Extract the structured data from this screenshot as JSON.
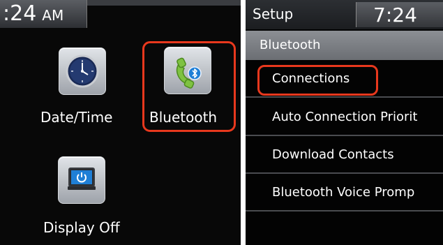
{
  "left_screen": {
    "clock": {
      "time": ":24",
      "ampm": "AM"
    },
    "items": [
      {
        "label": "Date/Time",
        "icon": "clock-icon"
      },
      {
        "label": "Bluetooth",
        "icon": "bluetooth-phone-icon"
      },
      {
        "label": "Display Off",
        "icon": "display-off-icon"
      }
    ]
  },
  "right_screen": {
    "title": "Setup",
    "clock": "7:24",
    "section_header": "Bluetooth",
    "menu": [
      {
        "label": "Connections"
      },
      {
        "label": "Auto Connection Priorit"
      },
      {
        "label": "Download Contacts"
      },
      {
        "label": "Bluetooth Voice Promp"
      }
    ]
  },
  "colors": {
    "highlight": "#e8381d",
    "screen_bg": "#080808",
    "header_gray": "#7b7e83",
    "icon_green": "#7fc241",
    "icon_blue": "#1f7fd6"
  }
}
